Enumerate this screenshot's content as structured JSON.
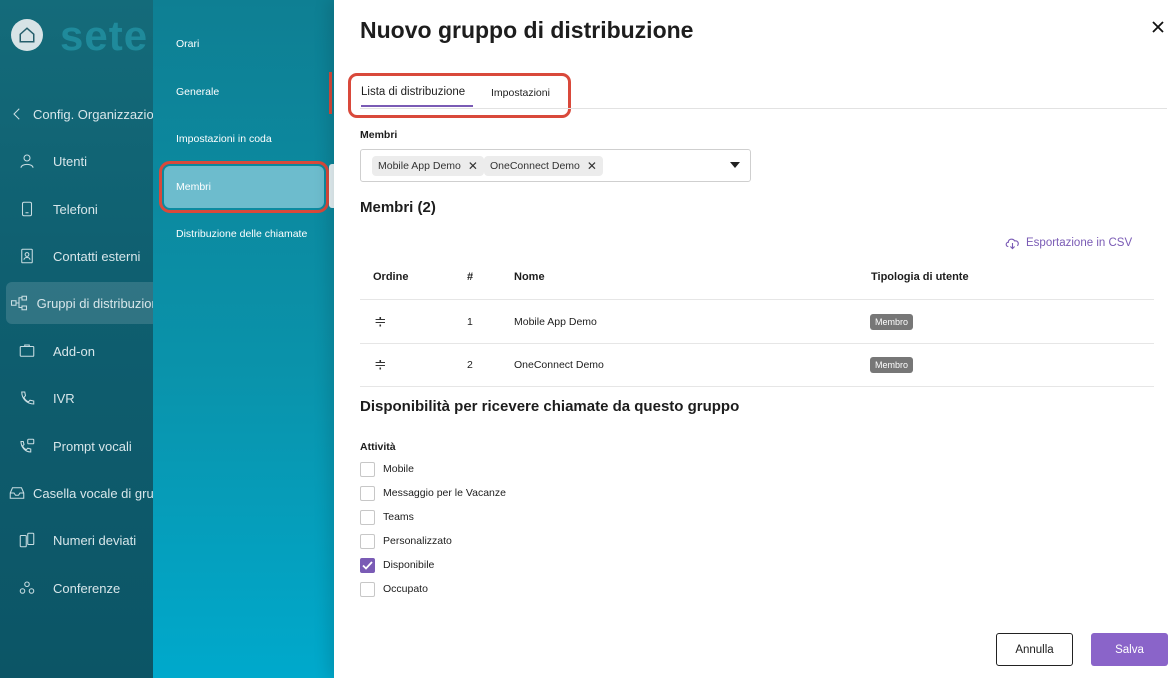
{
  "brand": {
    "logo_text": "sete",
    "accent": "#7a5bb5",
    "highlight": "#d9493b"
  },
  "sidebar": {
    "back_label": "Config. Organizzazione",
    "items": [
      {
        "label": "Utenti",
        "icon": "user-icon"
      },
      {
        "label": "Telefoni",
        "icon": "phone-icon"
      },
      {
        "label": "Contatti esterni",
        "icon": "contacts-icon"
      },
      {
        "label": "Gruppi di distribuzione",
        "icon": "distribution-icon",
        "active": true
      },
      {
        "label": "Add-on",
        "icon": "addon-icon"
      },
      {
        "label": "IVR",
        "icon": "ivr-icon"
      },
      {
        "label": "Prompt vocali",
        "icon": "voice-prompt-icon"
      },
      {
        "label": "Casella vocale di gruppo",
        "icon": "voicemail-icon"
      },
      {
        "label": "Numeri deviati",
        "icon": "forwarded-numbers-icon"
      },
      {
        "label": "Conferenze",
        "icon": "conference-icon"
      }
    ]
  },
  "subnav": {
    "items": [
      {
        "label": "Orari"
      },
      {
        "label": "Generale"
      },
      {
        "label": "Impostazioni in coda"
      },
      {
        "label": "Membri",
        "active": true
      },
      {
        "label": "Distribuzione delle chiamate"
      }
    ]
  },
  "panel": {
    "title": "Nuovo gruppo di distribuzione",
    "tabs": [
      {
        "label": "Lista di distribuzione",
        "active": true
      },
      {
        "label": "Impostazioni"
      }
    ],
    "members_field_label": "Membri",
    "chips": [
      "Mobile App Demo",
      "OneConnect Demo"
    ],
    "members_section_title": "Membri (2)",
    "csv_export_label": "Esportazione in CSV",
    "table": {
      "headers": [
        "Ordine",
        "#",
        "Nome",
        "Tipologia di utente"
      ],
      "rows": [
        {
          "num": "1",
          "name": "Mobile App Demo",
          "type": "Membro"
        },
        {
          "num": "2",
          "name": "OneConnect Demo",
          "type": "Membro"
        }
      ]
    },
    "availability_title": "Disponibilità per ricevere chiamate da questo gruppo",
    "activities_label": "Attività",
    "activities": [
      {
        "label": "Mobile",
        "checked": false
      },
      {
        "label": "Messaggio per le Vacanze",
        "checked": false
      },
      {
        "label": "Teams",
        "checked": false
      },
      {
        "label": "Personalizzato",
        "checked": false
      },
      {
        "label": "Disponibile",
        "checked": true
      },
      {
        "label": "Occupato",
        "checked": false
      }
    ],
    "cancel_label": "Annulla",
    "save_label": "Salva"
  }
}
